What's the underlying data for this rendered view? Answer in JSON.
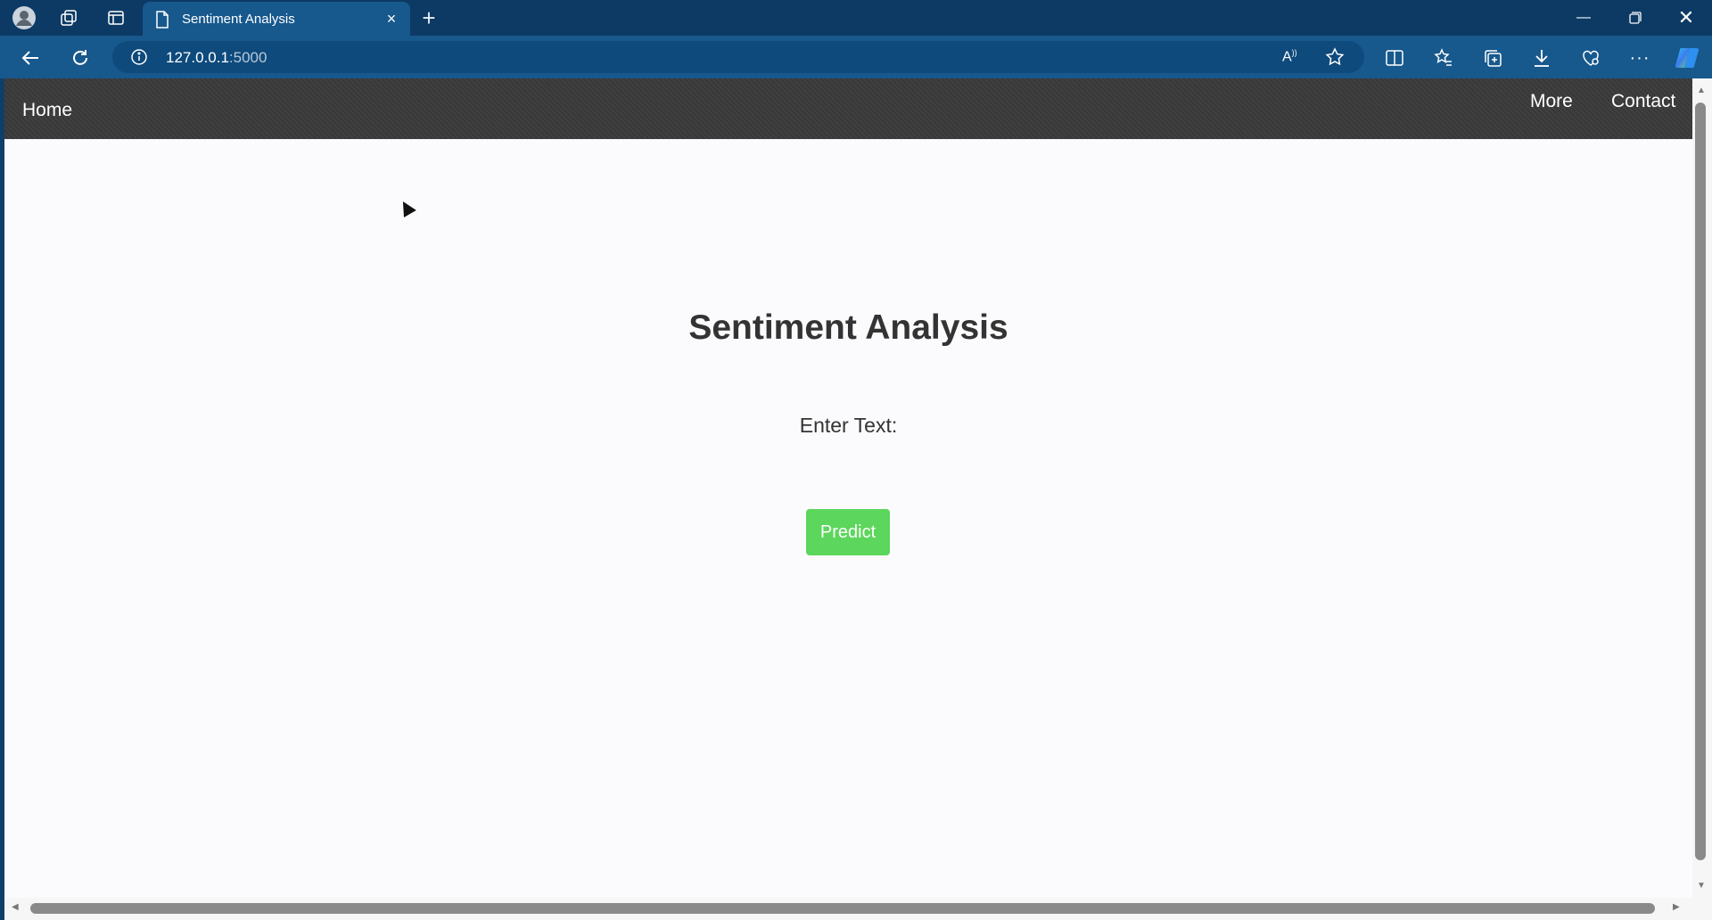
{
  "browser": {
    "tab_title": "Sentiment Analysis",
    "url_host": "127.0.0.1",
    "url_port": ":5000"
  },
  "navbar": {
    "home": "Home",
    "more": "More",
    "contact": "Contact"
  },
  "main": {
    "heading": "Sentiment Analysis",
    "input_label": "Enter Text:",
    "predict_button": "Predict"
  },
  "colors": {
    "navbar_bg": "#3a3a3a",
    "predict_button_bg": "#5cd65c",
    "page_bg": "#fbfbfe",
    "browser_chrome": "#17588d"
  }
}
